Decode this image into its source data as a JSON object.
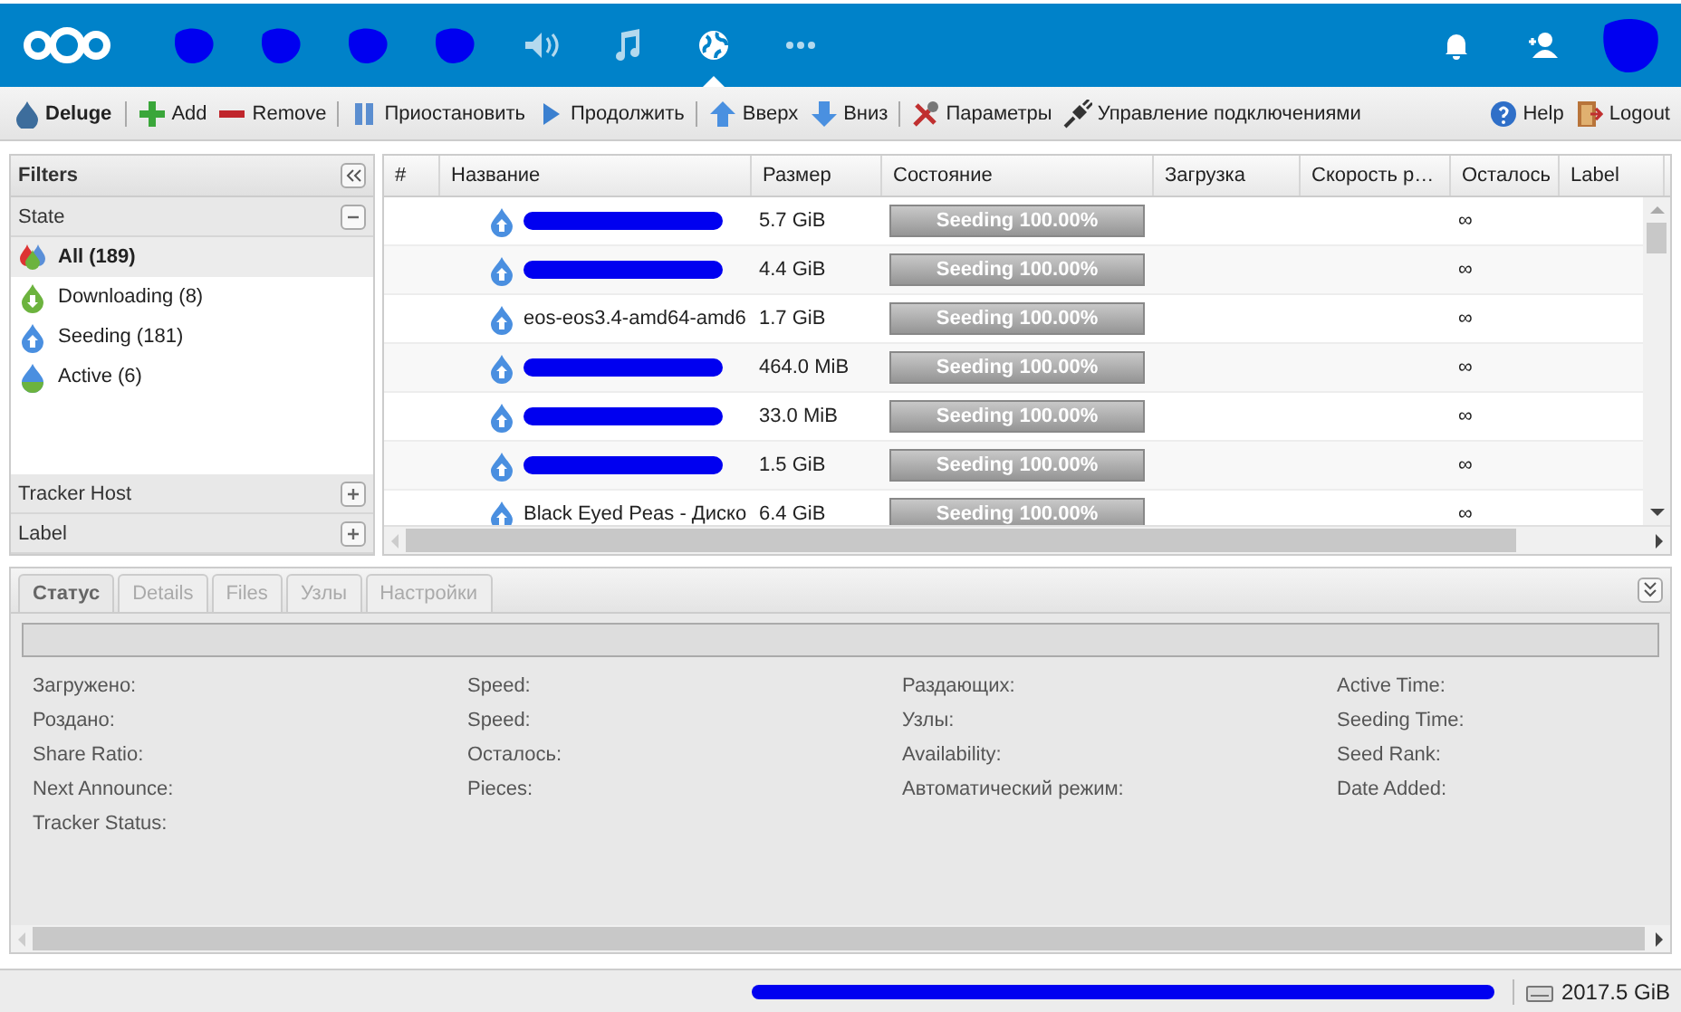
{
  "topbar": {
    "apps": [
      {
        "kind": "redacted"
      },
      {
        "kind": "redacted"
      },
      {
        "kind": "redacted"
      },
      {
        "kind": "redacted"
      },
      {
        "kind": "audio"
      },
      {
        "kind": "music"
      },
      {
        "kind": "globe",
        "selected": true
      },
      {
        "kind": "more"
      }
    ],
    "right": [
      {
        "kind": "bell"
      },
      {
        "kind": "contacts"
      },
      {
        "kind": "redacted"
      }
    ]
  },
  "toolbar": {
    "brand": "Deluge",
    "buttons": [
      {
        "kind": "add",
        "label": "Add"
      },
      {
        "kind": "remove",
        "label": "Remove"
      },
      {
        "kind": "sep"
      },
      {
        "kind": "pause",
        "label": "Приостановить"
      },
      {
        "kind": "play",
        "label": "Продолжить"
      },
      {
        "kind": "sep"
      },
      {
        "kind": "up",
        "label": "Вверх"
      },
      {
        "kind": "down",
        "label": "Вниз"
      },
      {
        "kind": "sep"
      },
      {
        "kind": "tools",
        "label": "Параметры"
      },
      {
        "kind": "plug",
        "label": "Управление подключениями"
      }
    ],
    "right": [
      {
        "kind": "help",
        "label": "Help"
      },
      {
        "kind": "logout",
        "label": "Logout"
      }
    ]
  },
  "filters": {
    "title": "Filters",
    "state": {
      "title": "State",
      "expanded": true,
      "items": [
        {
          "kind": "all",
          "label": "All (189)",
          "selected": true
        },
        {
          "kind": "downloading",
          "label": "Downloading (8)",
          "selected": false
        },
        {
          "kind": "seeding",
          "label": "Seeding (181)",
          "selected": false
        },
        {
          "kind": "active",
          "label": "Active (6)",
          "selected": false
        }
      ]
    },
    "sections": [
      {
        "title": "Tracker Host",
        "expanded": false
      },
      {
        "title": "Label",
        "expanded": false
      }
    ]
  },
  "table": {
    "columns": [
      "#",
      "Название",
      "Размер",
      "Состояние",
      "Загрузка",
      "Скорость р…",
      "Осталось",
      "Label"
    ],
    "rows": [
      {
        "name_redacted": true,
        "size": "5.7 GiB",
        "state": "Seeding 100.00%",
        "level": 1,
        "eta": "∞"
      },
      {
        "name_redacted": true,
        "size": "4.4 GiB",
        "state": "Seeding 100.00%",
        "level": 1,
        "eta": "∞"
      },
      {
        "name": "eos-eos3.4-amd64-amd6",
        "size": "1.7 GiB",
        "state": "Seeding 100.00%",
        "level": 1,
        "eta": "∞"
      },
      {
        "name_redacted": true,
        "size": "464.0 MiB",
        "state": "Seeding 100.00%",
        "level": 1,
        "eta": "∞"
      },
      {
        "name_redacted": true,
        "size": "33.0 MiB",
        "state": "Seeding 100.00%",
        "level": 1,
        "eta": "∞"
      },
      {
        "name_redacted": true,
        "size": "1.5 GiB",
        "state": "Seeding 100.00%",
        "level": 1,
        "eta": "∞"
      },
      {
        "name": "Black Eyed Peas - Диско",
        "size": "6.4 GiB",
        "state": "Seeding 100.00%",
        "level": 1,
        "eta": "∞"
      }
    ]
  },
  "details": {
    "progress": {
      "level": 0
    },
    "tabs": [
      {
        "label": "Статус",
        "selected": true
      },
      {
        "label": "Details",
        "selected": false
      },
      {
        "label": "Files",
        "selected": false
      },
      {
        "label": "Узлы",
        "selected": false
      },
      {
        "label": "Настройки",
        "selected": false
      }
    ],
    "columns": [
      [
        "Загружено:",
        "Роздано:",
        "Share Ratio:",
        "Next Announce:",
        "Tracker Status:"
      ],
      [
        "Speed:",
        "Speed:",
        "Осталось:",
        "Pieces:"
      ],
      [
        "Раздающих:",
        "Узлы:",
        "Availability:",
        "Автоматический режим:"
      ],
      [
        "Active Time:",
        "Seeding Time:",
        "Seed Rank:",
        "Date Added:"
      ]
    ]
  },
  "status_bar": {
    "redacted": true,
    "disk": "2017.5 GiB"
  }
}
